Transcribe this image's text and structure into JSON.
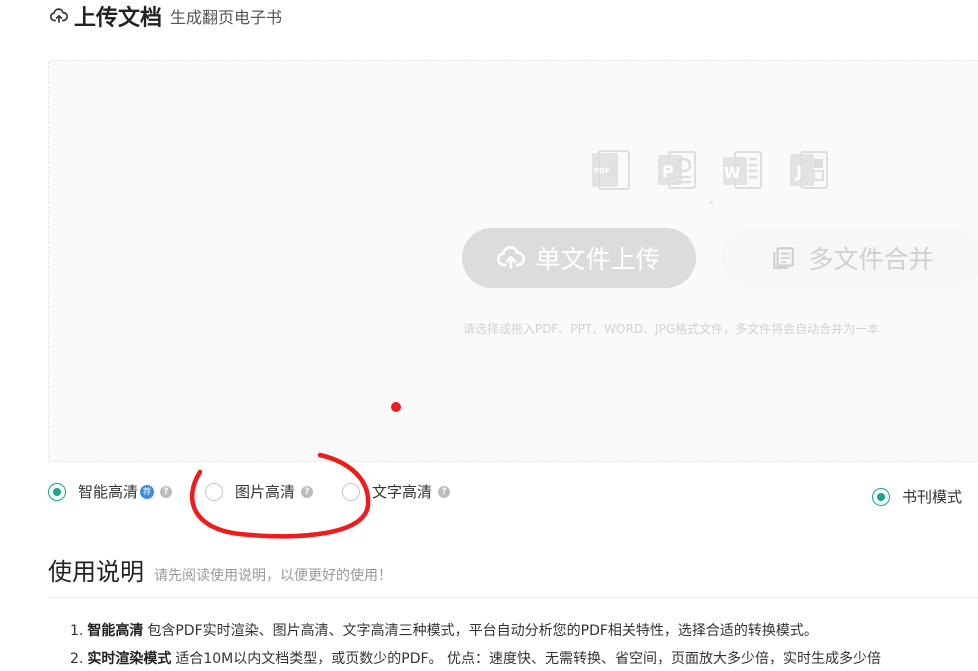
{
  "header": {
    "title": "上传文档",
    "subtitle": "生成翻页电子书",
    "icon": "cloud-upload-icon"
  },
  "upload": {
    "file_types": [
      {
        "name": "pdf-icon",
        "letter": "PDF",
        "color": "#dcdcdc"
      },
      {
        "name": "ppt-icon",
        "letter": "P",
        "color": "#dcdcdc"
      },
      {
        "name": "word-icon",
        "letter": "W",
        "color": "#dcdcdc"
      },
      {
        "name": "jpg-icon",
        "letter": "J",
        "color": "#dcdcdc"
      }
    ],
    "single_button": "单文件上传",
    "multi_button": "多文件合并",
    "hint": "请选择或拖入PDF、PPT、WORD、JPG格式文件，多文件将会自动合并为一本"
  },
  "options": {
    "smart": {
      "label": "智能高清",
      "badge": "荐",
      "help": "?",
      "checked": true
    },
    "image": {
      "label": "图片高清",
      "help": "?",
      "checked": false
    },
    "text": {
      "label": "文字高清",
      "help": "?",
      "checked": false
    },
    "book": {
      "label": "书刊模式",
      "checked": true
    }
  },
  "usage": {
    "title": "使用说明",
    "subtitle": "请先阅读使用说明，以便更好的使用！",
    "items": [
      {
        "num": "1.",
        "bold": "智能高清",
        "text": "包含PDF实时渲染、图片高清、文字高清三种模式，平台自动分析您的PDF相关特性，选择合适的转换模式。"
      },
      {
        "num": "2.",
        "bold": "实时渲染模式",
        "text": "适合10M以内文档类型，或页数少的PDF。 优点：速度快、无需转换、省空间，页面放大多少倍，实时生成多少倍"
      }
    ]
  },
  "colors": {
    "accent": "#18a58c",
    "annotation": "#ee1c1c",
    "badge": "#3a8ee6"
  }
}
